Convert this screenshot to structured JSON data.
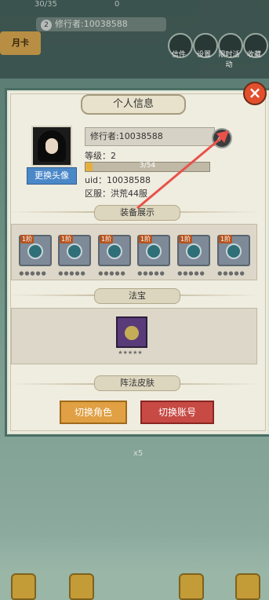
{
  "topbar": {
    "stats_left": "30/35",
    "stats_right": "0",
    "badge": "2",
    "player_name": "修行者:10038588",
    "monthly_card": "月卡",
    "menu": [
      {
        "label": "信件",
        "icon": "mail-icon"
      },
      {
        "label": "设置",
        "icon": "gear-icon"
      },
      {
        "label": "限时活动",
        "icon": "event-icon"
      },
      {
        "label": "收藏",
        "icon": "collection-icon"
      }
    ]
  },
  "dialog": {
    "title": "个人信息",
    "close_icon": "close-icon",
    "change_avatar": "更换头像",
    "name": "修行者:10038588",
    "level_label": "等级：",
    "level_value": "2",
    "exp_text": "3/54",
    "exp_fraction": 0.055,
    "uid_label": "uid：",
    "uid_value": "10038588",
    "server_label": "区服：",
    "server_value": "洪荒44服",
    "equipment_header": "装备展示",
    "equipment": [
      {
        "tier": "1阶",
        "stars": "●●●●●"
      },
      {
        "tier": "1阶",
        "stars": "●●●●●"
      },
      {
        "tier": "1阶",
        "stars": "●●●●●"
      },
      {
        "tier": "1阶",
        "stars": "●●●●●"
      },
      {
        "tier": "1阶",
        "stars": "●●●●●"
      },
      {
        "tier": "1阶",
        "stars": "●●●●●"
      }
    ],
    "fabao_header": "法宝",
    "fabao_stars": "★★★★★",
    "formation_header": "阵法皮肤",
    "switch_role": "切换角色",
    "switch_account": "切换账号"
  },
  "background": {
    "count_label": "x5"
  },
  "colors": {
    "panel_border": "#4a6e63",
    "accent_orange": "#e0a043",
    "accent_red": "#c74a44",
    "link_blue": "#4a88c8",
    "arrow_red": "#e8524a"
  }
}
